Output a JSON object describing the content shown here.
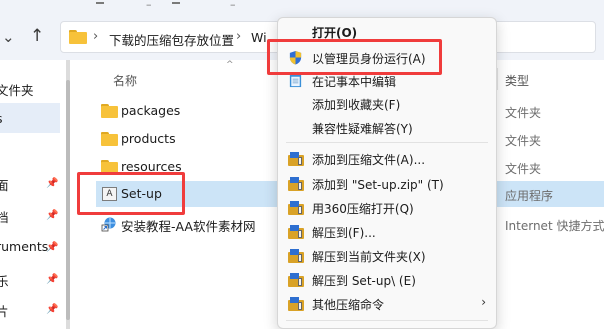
{
  "address_bar": {
    "crumb_downloads": "下载的压缩包存放位置",
    "crumb_partial": "Wi"
  },
  "nav": {
    "items": [
      {
        "label": "文件夹"
      },
      {
        "label": "s"
      },
      {
        "label": "面"
      },
      {
        "label": "档"
      },
      {
        "label": "ruments"
      },
      {
        "label": "乐"
      },
      {
        "label": "片"
      },
      {
        "label": "频"
      }
    ]
  },
  "columns": {
    "name": "名称",
    "type": "类型"
  },
  "files": [
    {
      "name": "packages",
      "type": "文件夹",
      "icon": "folder-icon"
    },
    {
      "name": "products",
      "type": "文件夹",
      "icon": "folder-icon"
    },
    {
      "name": "resources",
      "type": "文件夹",
      "icon": "folder-icon"
    },
    {
      "name": "Set-up",
      "type": "应用程序",
      "icon": "installer-icon"
    },
    {
      "name": "安装教程-AA软件素材网",
      "type": "Internet 快捷方式",
      "icon": "internet-shortcut-icon"
    }
  ],
  "context_menu": {
    "items": [
      {
        "label": "打开(O)",
        "icon": ""
      },
      {
        "label": "以管理员身份运行(A)",
        "icon": "uac-shield-icon"
      },
      {
        "label": "在记事本中编辑",
        "icon": "notepad-icon"
      },
      {
        "label": "添加到收藏夹(F)",
        "icon": ""
      },
      {
        "label": "兼容性疑难解答(Y)",
        "icon": ""
      },
      {
        "label": "添加到压缩文件(A)...",
        "icon": "archive-icon"
      },
      {
        "label": "添加到 \"Set-up.zip\" (T)",
        "icon": "archive-icon"
      },
      {
        "label": "用360压缩打开(Q)",
        "icon": "archive-icon"
      },
      {
        "label": "解压到(F)...",
        "icon": "archive-icon"
      },
      {
        "label": "解压到当前文件夹(X)",
        "icon": "archive-icon"
      },
      {
        "label": "解压到 Set-up\\ (E)",
        "icon": "archive-icon"
      },
      {
        "label": "其他压缩命令",
        "icon": "archive-icon"
      }
    ]
  },
  "colors": {
    "highlight": "#f03c3c",
    "selection": "#cce4f7",
    "folder": "#f7c23a"
  }
}
